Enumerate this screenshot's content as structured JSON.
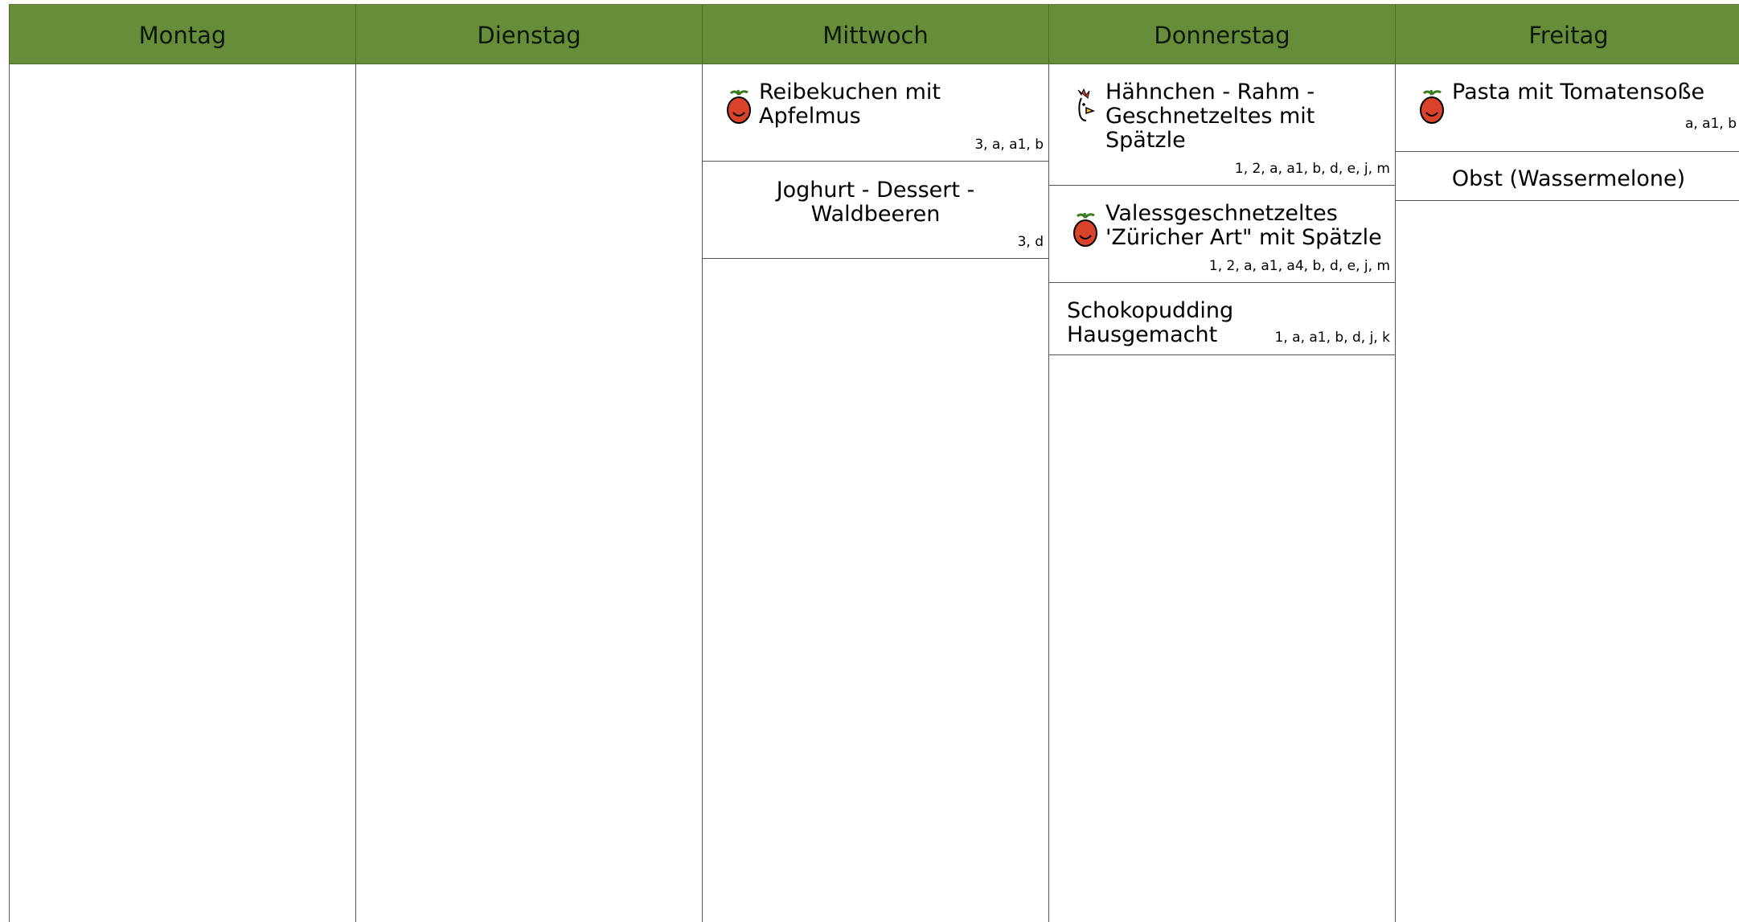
{
  "days": [
    {
      "label": "Montag",
      "meals": []
    },
    {
      "label": "Dienstag",
      "meals": []
    },
    {
      "label": "Mittwoch",
      "meals": [
        {
          "icon": "tomato-icon",
          "title": "Reibekuchen mit Apfelmus",
          "codes": "3, a, a1, b"
        },
        {
          "icon": "",
          "title": "Joghurt - Dessert - Waldbeeren",
          "codes": "3, d"
        }
      ]
    },
    {
      "label": "Donnerstag",
      "meals": [
        {
          "icon": "chicken-icon",
          "title": "Hähnchen - Rahm - Geschnetzeltes mit Spätzle",
          "codes": "1, 2, a, a1, b, d, e, j, m"
        },
        {
          "icon": "tomato-icon",
          "title": "Valessgeschnetzeltes 'Züricher Art\" mit Spätzle",
          "codes": "1, 2, a, a1, a4, b, d, e, j, m"
        },
        {
          "icon": "",
          "title": "Schokopudding Hausgemacht",
          "codes": "1, a, a1, b, d, j, k"
        }
      ]
    },
    {
      "label": "Freitag",
      "meals": [
        {
          "icon": "tomato-icon",
          "title": "Pasta mit Tomatensoße",
          "codes": "a, a1, b"
        },
        {
          "icon": "",
          "title": "Obst (Wassermelone)",
          "codes": ""
        }
      ]
    }
  ],
  "colors": {
    "header": "#678d3a",
    "tomato": "#d9432b",
    "leaf": "#3b7a1c"
  }
}
